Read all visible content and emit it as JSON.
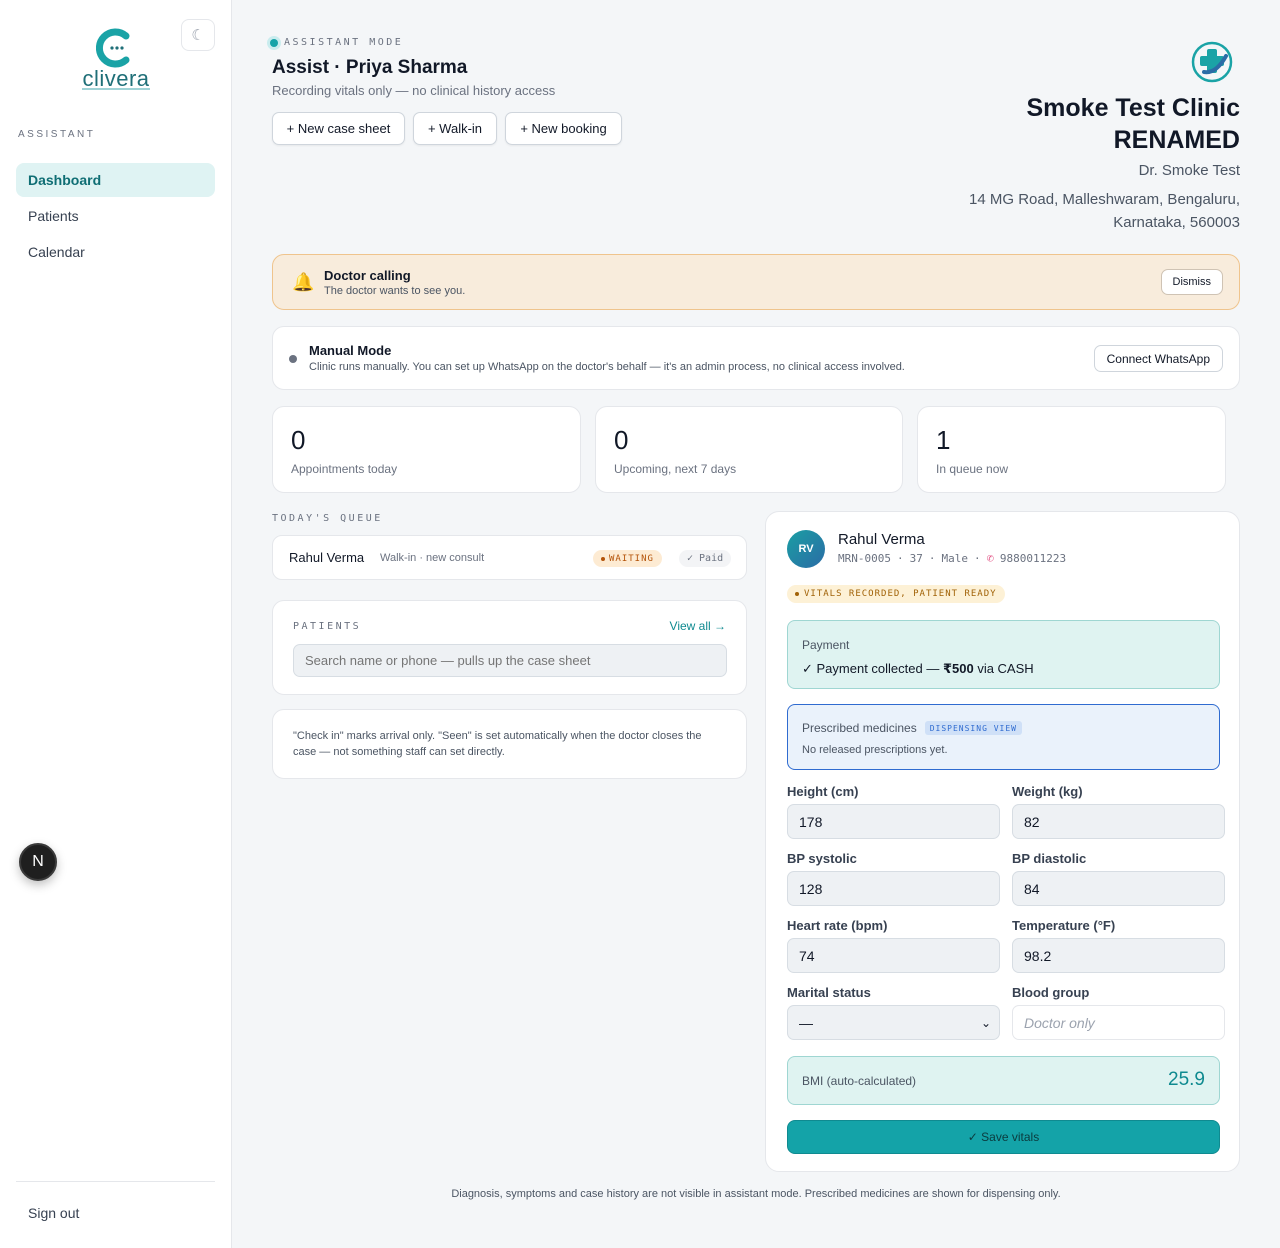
{
  "sidebar": {
    "logo_text": "clivera",
    "theme_toggle_icon": "moon-icon",
    "section_label": "ASSISTANT",
    "items": [
      {
        "label": "Dashboard",
        "active": true
      },
      {
        "label": "Patients",
        "active": false
      },
      {
        "label": "Calendar",
        "active": false
      }
    ],
    "sign_out": "Sign out",
    "dev_badge": "N"
  },
  "header": {
    "mode_tag": "ASSISTANT MODE",
    "title": "Assist · Priya Sharma",
    "subtitle": "Recording vitals only — no clinical history access",
    "buttons": [
      "+ New case sheet",
      "+ Walk-in",
      "+ New booking"
    ]
  },
  "clinic": {
    "name_line1": "Smoke Test Clinic",
    "name_line2": "RENAMED",
    "doctor": "Dr. Smoke Test",
    "address_line1": "14 MG Road, Malleshwaram, Bengaluru,",
    "address_line2": "Karnataka, 560003"
  },
  "doctor_call": {
    "title": "Doctor calling",
    "subtitle": "The doctor wants to see you.",
    "dismiss": "Dismiss"
  },
  "manual_mode": {
    "title": "Manual Mode",
    "subtitle": "Clinic runs manually. You can set up WhatsApp on the doctor's behalf — it's an admin process, no clinical access involved.",
    "button": "Connect WhatsApp"
  },
  "stats": [
    {
      "value": "0",
      "label": "Appointments today"
    },
    {
      "value": "0",
      "label": "Upcoming, next 7 days"
    },
    {
      "value": "1",
      "label": "In queue now"
    }
  ],
  "queue": {
    "section_label": "TODAY'S QUEUE",
    "rows": [
      {
        "name": "Rahul Verma",
        "type": "Walk-in · new consult",
        "status": "WAITING",
        "payment": "✓ Paid"
      }
    ]
  },
  "patients_card": {
    "title": "PATIENTS",
    "view_all": "View all →",
    "search_placeholder": "Search name or phone — pulls up the case sheet"
  },
  "note": "\"Check in\" marks arrival only. \"Seen\" is set automatically when the doctor closes the case — not something staff can set directly.",
  "patient": {
    "initials": "RV",
    "name": "Rahul Verma",
    "mrn": "MRN-0005",
    "age": "37",
    "sex": "Male",
    "phone": "9880011223",
    "status_badge": "VITALS RECORDED, PATIENT READY",
    "payment_label": "Payment",
    "payment_prefix": "✓ Payment collected — ",
    "payment_amount": "₹500",
    "payment_suffix": " via CASH",
    "rx_label": "Prescribed medicines",
    "rx_tag": "DISPENSING VIEW",
    "rx_sub": "No released prescriptions yet.",
    "fields": {
      "height_label": "Height (cm)",
      "height": "178",
      "weight_label": "Weight (kg)",
      "weight": "82",
      "bps_label": "BP systolic",
      "bps": "128",
      "bpd_label": "BP diastolic",
      "bpd": "84",
      "hr_label": "Heart rate (bpm)",
      "hr": "74",
      "temp_label": "Temperature (°F)",
      "temp": "98.2",
      "marital_label": "Marital status",
      "marital": "—",
      "blood_label": "Blood group",
      "blood_placeholder": "Doctor only"
    },
    "bmi_label": "BMI (auto-calculated)",
    "bmi_value": "25.9",
    "save": "✓ Save vitals"
  },
  "footer": "Diagnosis, symptoms and case history are not visible in assistant mode. Prescribed medicines are shown for dispensing only.",
  "colors": {
    "accent": "#14a3a8",
    "warning": "#f8ecdc",
    "info": "#eaf2fb"
  }
}
